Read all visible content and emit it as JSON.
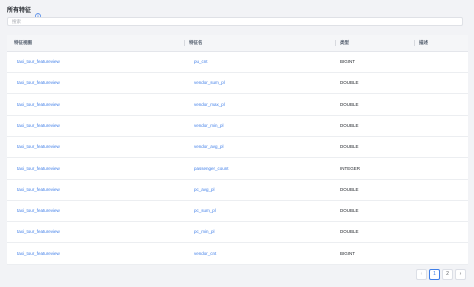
{
  "header": {
    "title": "所有特征"
  },
  "search": {
    "placeholder": "搜索"
  },
  "table": {
    "columns": [
      "特征视图",
      "特征名",
      "类型",
      "描述"
    ],
    "rows": [
      {
        "view": "taxi_tour_featureview",
        "name": "pu_cnt",
        "type": "BIGINT",
        "desc": ""
      },
      {
        "view": "taxi_tour_featureview",
        "name": "vendor_sum_pl",
        "type": "DOUBLE",
        "desc": ""
      },
      {
        "view": "taxi_tour_featureview",
        "name": "vendor_max_pl",
        "type": "DOUBLE",
        "desc": ""
      },
      {
        "view": "taxi_tour_featureview",
        "name": "vendor_min_pl",
        "type": "DOUBLE",
        "desc": ""
      },
      {
        "view": "taxi_tour_featureview",
        "name": "vendor_avg_pl",
        "type": "DOUBLE",
        "desc": ""
      },
      {
        "view": "taxi_tour_featureview",
        "name": "passenger_count",
        "type": "INTEGER",
        "desc": ""
      },
      {
        "view": "taxi_tour_featureview",
        "name": "pc_avg_pl",
        "type": "DOUBLE",
        "desc": ""
      },
      {
        "view": "taxi_tour_featureview",
        "name": "pc_sum_pl",
        "type": "DOUBLE",
        "desc": ""
      },
      {
        "view": "taxi_tour_featureview",
        "name": "pc_min_pl",
        "type": "DOUBLE",
        "desc": ""
      },
      {
        "view": "taxi_tour_featureview",
        "name": "vendor_cnt",
        "type": "BIGINT",
        "desc": ""
      }
    ]
  },
  "pagination": {
    "prev": "‹",
    "pages": [
      "1",
      "2"
    ],
    "current": "1",
    "next": "›"
  },
  "colors": {
    "link": "#3f7ee8",
    "background": "#f2f3f6"
  },
  "icons": {
    "title_info": "info-circle-icon"
  }
}
